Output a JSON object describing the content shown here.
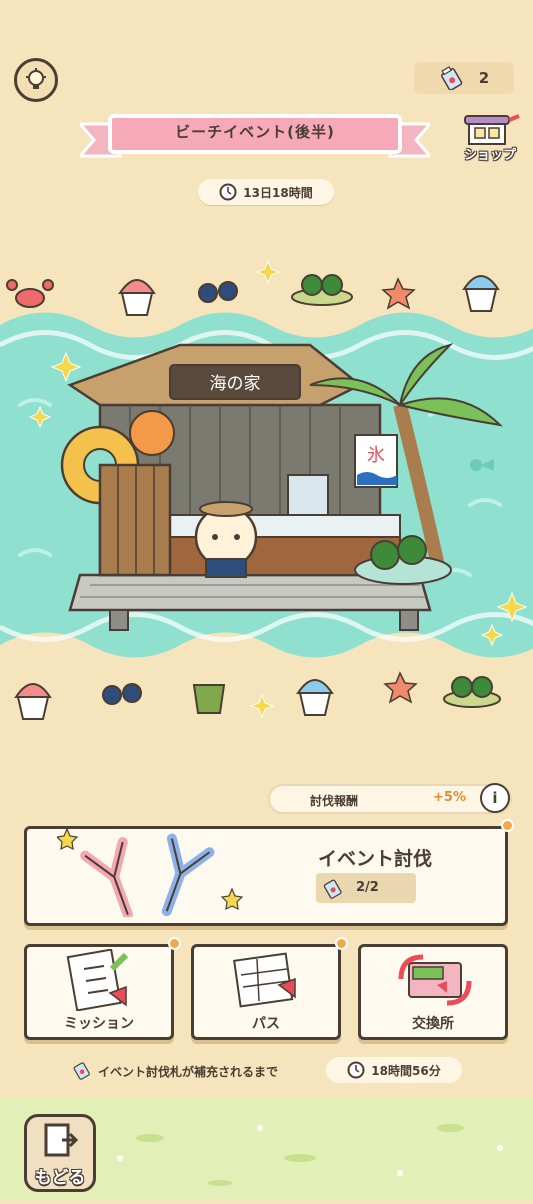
{
  "header": {
    "ticket_count": "2",
    "event_title": "ビーチイベント(後半)",
    "shop_label": "ショップ",
    "remaining_time": "13日18時間"
  },
  "scene": {
    "signboard": "海の家",
    "banner_char": "氷"
  },
  "bonus": {
    "label": "討伐報酬",
    "value": "+5%",
    "info": "i"
  },
  "battle": {
    "title": "イベント討伐",
    "count": "2/2"
  },
  "menu": {
    "mission": "ミッション",
    "pass": "パス",
    "exchange": "交換所"
  },
  "refill": {
    "text": "イベント討伐札が補充されるまで",
    "time": "18時間56分"
  },
  "footer": {
    "back_label": "もどる"
  },
  "colors": {
    "background": "#f6e4bd",
    "sea": "#8fe0cf",
    "ribbon": "#f6a9b8",
    "accent": "#e98a2f"
  }
}
